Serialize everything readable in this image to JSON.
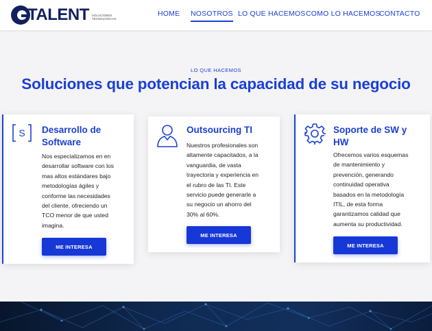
{
  "brand": {
    "name": "TALENT",
    "tagline": "SOLUCIONES TECNOLÓGICAS"
  },
  "nav": {
    "items": [
      {
        "label": "HOME"
      },
      {
        "label": "NOSOTROS"
      },
      {
        "label": "LO QUE HACEMOS"
      },
      {
        "label": "COMO LO HACEMOS"
      },
      {
        "label": "CONTACTO"
      }
    ],
    "active": "NOSOTROS"
  },
  "section": {
    "kicker": "LO QUE HACEMOS",
    "title": "Soluciones que potencian la capacidad de su negocio"
  },
  "cards": [
    {
      "icon": "code-brackets-icon",
      "icon_text": "[ S ]",
      "title_lines": [
        "Desarrollo de",
        "Software"
      ],
      "body_lines": [
        "Nos especializamos en en",
        "desarrollar software con los",
        "mas altos estándares bajo",
        "metodologías ágiles y",
        "conforme las necesidades",
        "del cliente, ofreciendo un",
        "TCO menor de que usted",
        "imagina."
      ],
      "button": "ME INTERESA"
    },
    {
      "icon": "person-icon",
      "title_lines": [
        "Outsourcing TI"
      ],
      "body_lines": [
        "Nuestros profesionales son",
        "altamente capacitados, a la",
        "vanguardia, de vasta",
        "trayectoria y experiencia en",
        "el rubro de las TI. Este",
        "servicio puede generarle a",
        "su negocio un ahorro del",
        "30% al 60%."
      ],
      "button": "ME INTERESA"
    },
    {
      "icon": "gear-icon",
      "title_lines": [
        "Soporte de SW y",
        "HW"
      ],
      "body_lines": [
        "Ofrecemos varios esquemas",
        "de mantenimiento y",
        "prevención, generando",
        "continuidad operativa",
        "basados en la metodología",
        "ITIL, de esta forma",
        "garantizamos calidad que",
        "aumenta su productividad."
      ],
      "button": "ME INTERESA"
    }
  ],
  "colors": {
    "accent": "#1a3fd3",
    "button": "#1638d6",
    "page_bg": "#f4f4f6",
    "brand_dark": "#12205e"
  }
}
